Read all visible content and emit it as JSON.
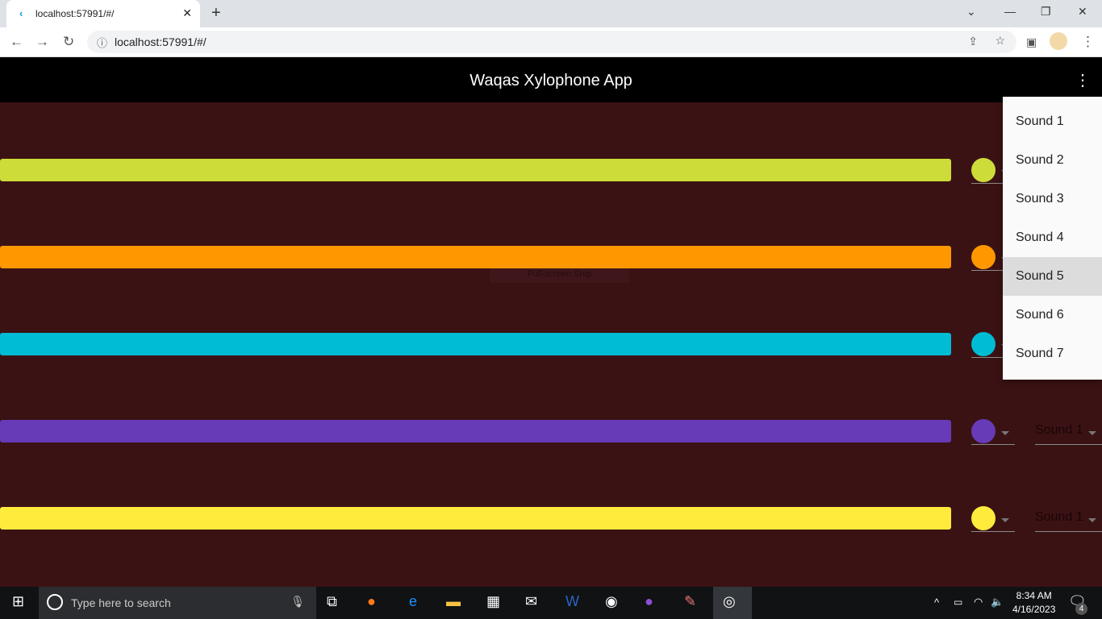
{
  "browser": {
    "tab_title": "localhost:57991/#/",
    "url": "localhost:57991/#/"
  },
  "app": {
    "title": "Waqas Xylophone App"
  },
  "rows": [
    {
      "color": "#cddc39",
      "sound": ""
    },
    {
      "color": "#ff9800",
      "sound": ""
    },
    {
      "color": "#00bcd4",
      "sound": ""
    },
    {
      "color": "#673ab7",
      "sound": "Sound 1"
    },
    {
      "color": "#ffeb3b",
      "sound": "Sound 1"
    }
  ],
  "menu": {
    "items": [
      "Sound 1",
      "Sound 2",
      "Sound 3",
      "Sound 4",
      "Sound 5",
      "Sound 6",
      "Sound 7"
    ],
    "highlighted": "Sound 5"
  },
  "overlay": {
    "snip_label": "Full-screen Snip"
  },
  "taskbar": {
    "search_placeholder": "Type here to search",
    "time": "8:34 AM",
    "date": "4/16/2023",
    "notifications": "4"
  }
}
